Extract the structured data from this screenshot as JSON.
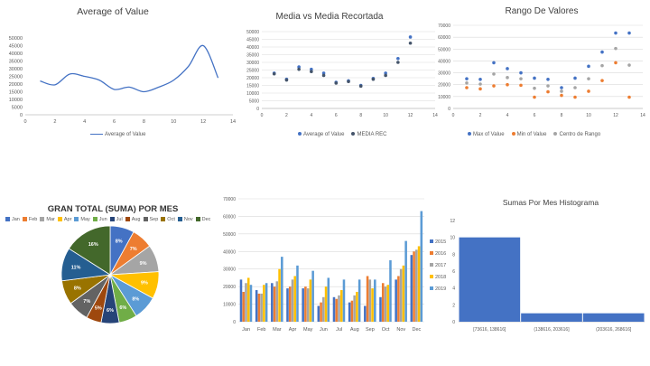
{
  "chart_data": [
    {
      "type": "line",
      "title": "Average of Value",
      "x": [
        1,
        2,
        3,
        4,
        5,
        6,
        7,
        8,
        9,
        10,
        11,
        12,
        13
      ],
      "series": [
        {
          "name": "Average of Value",
          "color": "#4472c4",
          "values": [
            22000,
            19500,
            26500,
            25000,
            22500,
            16500,
            18000,
            15000,
            18000,
            22500,
            31500,
            45000,
            24000
          ]
        }
      ],
      "xlim": [
        0,
        14
      ],
      "ylim": [
        0,
        50000
      ],
      "xticks": [
        0,
        2,
        4,
        6,
        8,
        10,
        12,
        14
      ],
      "yticks": [
        0,
        5000,
        10000,
        15000,
        20000,
        25000,
        30000,
        35000,
        40000,
        45000,
        50000
      ],
      "legend": "bottom",
      "grid": false
    },
    {
      "type": "scatter",
      "title": "Media vs Media Recortada",
      "x": [
        1,
        2,
        3,
        4,
        5,
        6,
        7,
        8,
        9,
        10,
        11,
        12
      ],
      "series": [
        {
          "name": "Average of Value",
          "color": "#4472c4",
          "values": [
            23000,
            19000,
            27000,
            25500,
            23000,
            17000,
            18000,
            15000,
            19500,
            23000,
            32500,
            46500
          ]
        },
        {
          "name": "MEDIA REC",
          "color": "#44546a",
          "values": [
            22500,
            18500,
            25500,
            24000,
            21500,
            16500,
            17500,
            14500,
            19000,
            21500,
            30000,
            42500
          ]
        }
      ],
      "xlim": [
        0,
        14
      ],
      "ylim": [
        0,
        50000
      ],
      "xticks": [
        0,
        2,
        4,
        6,
        8,
        10,
        12,
        14
      ],
      "yticks": [
        0,
        5000,
        10000,
        15000,
        20000,
        25000,
        30000,
        35000,
        40000,
        45000,
        50000
      ],
      "legend": "bottom",
      "grid": true
    },
    {
      "type": "scatter",
      "title": "Rango De Valores",
      "x": [
        1,
        2,
        3,
        4,
        5,
        6,
        7,
        8,
        9,
        10,
        11,
        12,
        13
      ],
      "series": [
        {
          "name": "Max of Value",
          "color": "#4472c4",
          "values": [
            25000,
            24500,
            38500,
            33500,
            30000,
            25500,
            24500,
            17500,
            25500,
            35500,
            47500,
            63500,
            63500
          ]
        },
        {
          "name": "Min of Value",
          "color": "#ed7d31",
          "values": [
            17500,
            16500,
            19000,
            20000,
            19500,
            9500,
            14000,
            11000,
            9500,
            14500,
            23500,
            38500,
            9500
          ]
        },
        {
          "name": "Centro de Rango",
          "color": "#a5a5a5",
          "values": [
            21500,
            20500,
            29000,
            26000,
            25000,
            17000,
            19000,
            14500,
            17500,
            25000,
            36000,
            50500,
            36500
          ]
        }
      ],
      "xlim": [
        0,
        14
      ],
      "ylim": [
        0,
        70000
      ],
      "xticks": [
        0,
        2,
        4,
        6,
        8,
        10,
        12,
        14
      ],
      "yticks": [
        0,
        10000,
        20000,
        30000,
        40000,
        50000,
        60000,
        70000
      ],
      "legend": "bottom",
      "grid": true
    },
    {
      "type": "pie",
      "title": "GRAN TOTAL (SUMA) POR MES",
      "categories": [
        "Jan",
        "Feb",
        "Mar",
        "Apr",
        "May",
        "Jun",
        "Jul",
        "Aug",
        "Sep",
        "Oct",
        "Nov",
        "Dec"
      ],
      "values": [
        8,
        7,
        9,
        9,
        8,
        6,
        6,
        5,
        7,
        8,
        11,
        16
      ],
      "colors": [
        "#4472c4",
        "#ed7d31",
        "#a5a5a5",
        "#ffc000",
        "#5b9bd5",
        "#70ad47",
        "#264478",
        "#9e480e",
        "#636363",
        "#997300",
        "#255e91",
        "#43682b"
      ],
      "legend": "top"
    },
    {
      "type": "bar",
      "categories": [
        "Jan",
        "Feb",
        "Mar",
        "Apr",
        "May",
        "Jun",
        "Jul",
        "Aug",
        "Sep",
        "Oct",
        "Nov",
        "Dec"
      ],
      "series": [
        {
          "name": "2015",
          "color": "#4472c4",
          "values": [
            24000,
            18000,
            22000,
            19000,
            19000,
            9000,
            14000,
            11000,
            9000,
            14000,
            24000,
            38000
          ]
        },
        {
          "name": "2016",
          "color": "#ed7d31",
          "values": [
            17000,
            16000,
            20000,
            20000,
            20000,
            11000,
            13000,
            12000,
            26000,
            22000,
            26000,
            40000
          ]
        },
        {
          "name": "2017",
          "color": "#a5a5a5",
          "values": [
            22000,
            16000,
            23000,
            24000,
            19000,
            14000,
            15000,
            15000,
            24000,
            20000,
            30000,
            41000
          ]
        },
        {
          "name": "2018",
          "color": "#ffc000",
          "values": [
            25000,
            21000,
            30000,
            26000,
            24000,
            20000,
            18000,
            17000,
            19000,
            21000,
            32000,
            43000
          ]
        },
        {
          "name": "2019",
          "color": "#5b9bd5",
          "values": [
            21000,
            22000,
            37000,
            32000,
            29000,
            25000,
            24000,
            24000,
            24000,
            35000,
            46000,
            63000
          ]
        }
      ],
      "ylim": [
        0,
        70000
      ],
      "yticks": [
        0,
        10000,
        20000,
        30000,
        40000,
        50000,
        60000,
        70000
      ],
      "legend": "right",
      "grid": true
    },
    {
      "type": "bar",
      "title": "Sumas Por Mes Histograma",
      "categories": [
        "[73616, 138616]",
        "(138616, 203616]",
        "(203616, 268616]"
      ],
      "values": [
        10,
        1,
        1
      ],
      "color": "#4472c4",
      "ylim": [
        0,
        12
      ],
      "yticks": [
        0,
        2,
        4,
        6,
        8,
        10,
        12
      ],
      "grid": false
    }
  ]
}
